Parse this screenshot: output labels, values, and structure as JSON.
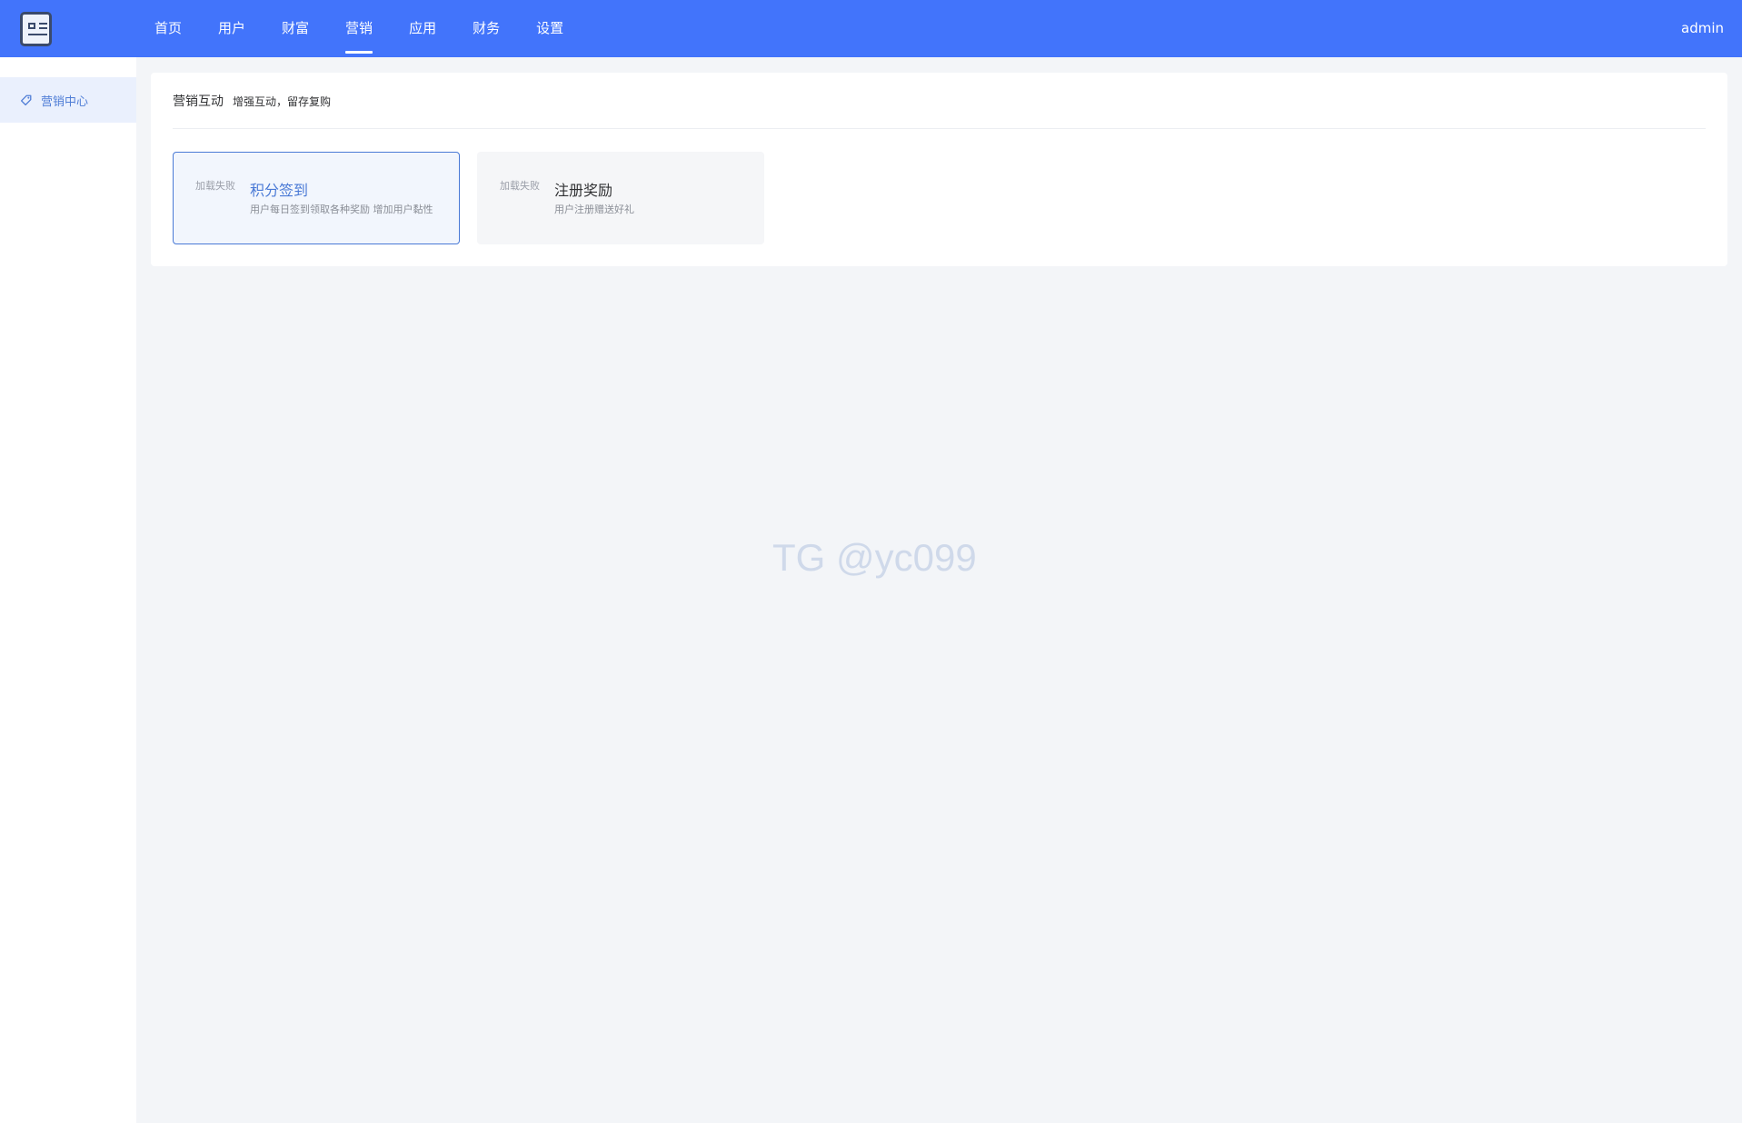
{
  "header": {
    "nav": [
      "首页",
      "用户",
      "财富",
      "营销",
      "应用",
      "财务",
      "设置"
    ],
    "active_nav": "营销",
    "user": "admin",
    "accent_color": "#4274fb"
  },
  "sidebar": {
    "items": [
      {
        "label": "营销中心",
        "icon": "tag-icon",
        "active": true
      }
    ]
  },
  "panel": {
    "title": "营销互动",
    "subtitle": "增强互动，留存复购",
    "cards": [
      {
        "image_alt": "加载失败",
        "name": "积分签到",
        "desc": "用户每日签到领取各种奖励 增加用户黏性",
        "selected": true
      },
      {
        "image_alt": "加载失败",
        "name": "注册奖励",
        "desc": "用户注册赠送好礼",
        "selected": false
      }
    ]
  },
  "watermark": "TG @yc099"
}
